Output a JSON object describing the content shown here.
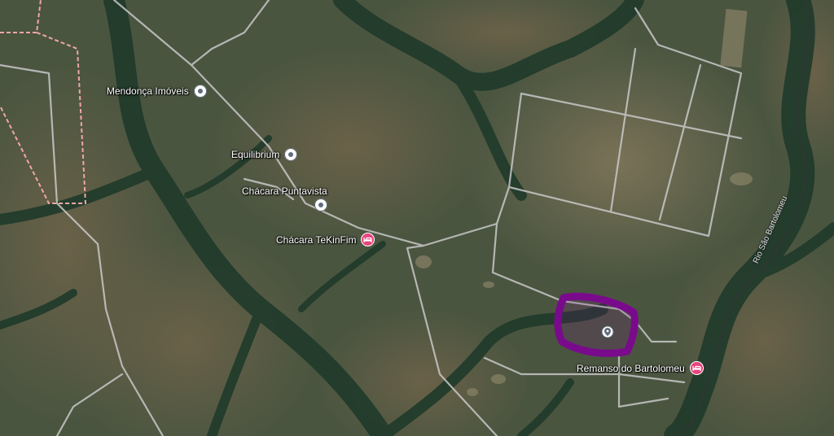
{
  "places": {
    "mendonca": {
      "label": "Mendonça Imóveis",
      "icon": "poi-pin-icon"
    },
    "equilibrium": {
      "label": "Equilibrium",
      "icon": "poi-pin-icon"
    },
    "puntavista": {
      "label": "Chácara Puntavista",
      "icon": "poi-pin-icon"
    },
    "tekinfim": {
      "label": "Chácara TeKinFim",
      "icon": "hotel-pin-icon"
    },
    "remanso": {
      "label": "Remanso do Bartolomeu",
      "icon": "hotel-pin-icon"
    }
  },
  "river": {
    "label": "Rio São Bartolomeu"
  },
  "colors": {
    "highlight": "#7a0a8c",
    "boundary": "#f0a6a6",
    "road": "#c8c8c8",
    "hotel_pin": "#e8447e"
  }
}
